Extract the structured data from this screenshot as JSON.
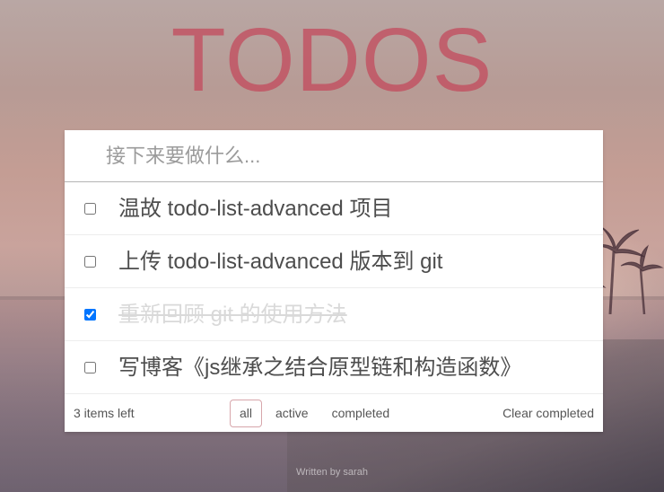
{
  "header": {
    "title": "TODOS"
  },
  "new_todo": {
    "placeholder": "接下来要做什么..."
  },
  "todos": [
    {
      "label": "温故 todo-list-advanced 项目",
      "completed": false
    },
    {
      "label": "上传 todo-list-advanced 版本到 git",
      "completed": false
    },
    {
      "label": "重新回顾 git 的使用方法",
      "completed": true
    },
    {
      "label": "写博客《js继承之结合原型链和构造函数》",
      "completed": false
    }
  ],
  "footer": {
    "items_left": "3 items left",
    "filters": [
      {
        "label": "all",
        "selected": true
      },
      {
        "label": "active",
        "selected": false
      },
      {
        "label": "completed",
        "selected": false
      }
    ],
    "clear_label": "Clear completed"
  },
  "credit": "Written by sarah",
  "colors": {
    "title": "#c4465a",
    "selected_filter_border": "#d7a6ab",
    "completed_text": "#d9d9d9"
  }
}
